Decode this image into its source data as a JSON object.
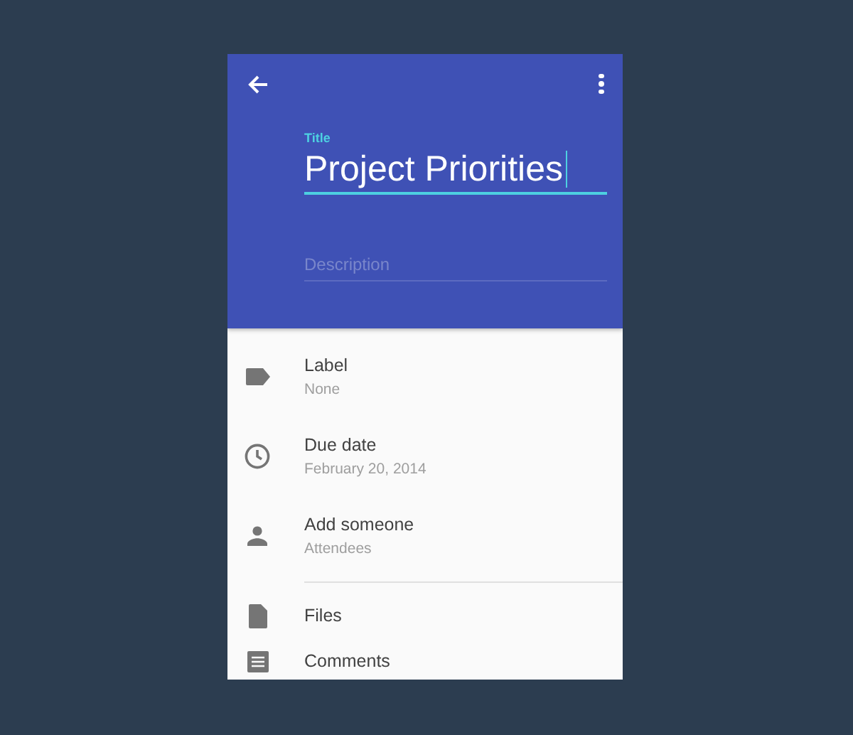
{
  "header": {
    "title_field": {
      "label": "Title",
      "value": "Project Priorities",
      "focused": true
    },
    "description_field": {
      "placeholder": "Description"
    }
  },
  "items": [
    {
      "kind": "label",
      "title": "Label",
      "subtitle": "None"
    },
    {
      "kind": "clock",
      "title": "Due date",
      "subtitle": "February 20, 2014"
    },
    {
      "kind": "person",
      "title": "Add someone",
      "subtitle": "Attendees"
    },
    {
      "kind": "divider"
    },
    {
      "kind": "file",
      "title": "Files"
    },
    {
      "kind": "comments",
      "title": "Comments"
    }
  ]
}
